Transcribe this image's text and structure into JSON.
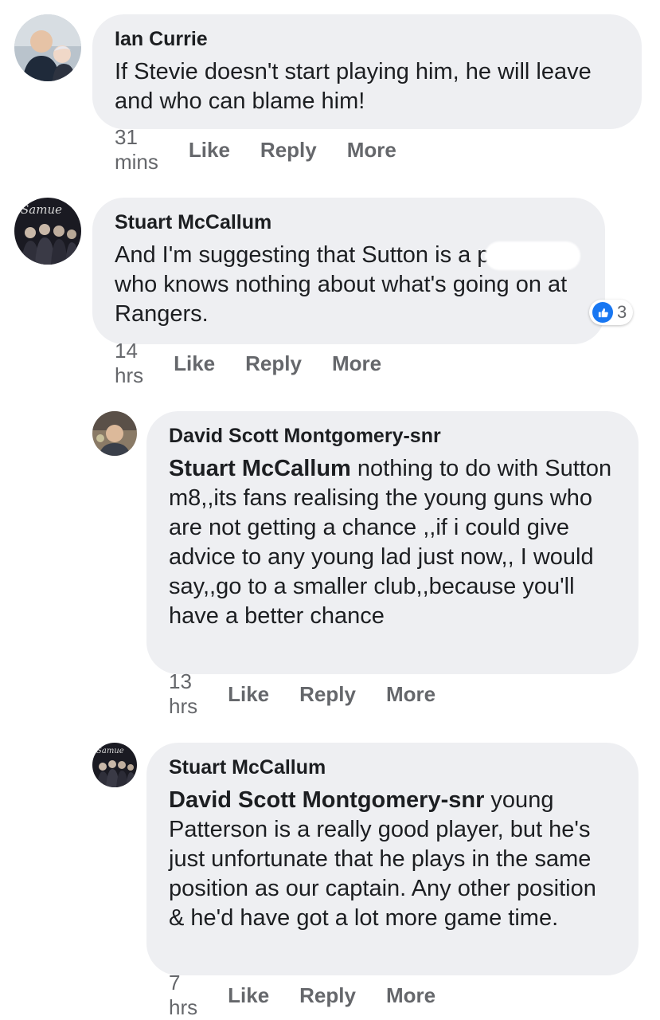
{
  "comments": [
    {
      "author": "Ian Currie",
      "mention": "",
      "text": "If Stevie doesn't start playing him, he will leave and who can blame him!",
      "time": "31 mins",
      "like": "Like",
      "reply": "Reply",
      "more": "More"
    },
    {
      "author": "Stuart McCallum",
      "mention": "",
      "text_before": "And I'm suggesting that Sutton is a p",
      "text_after": "who knows nothing about what's going on at Rangers.",
      "reaction_count": "3",
      "time": "14 hrs",
      "like": "Like",
      "reply": "Reply",
      "more": "More"
    },
    {
      "author": "David Scott Montgomery-snr",
      "mention": "Stuart McCallum",
      "text": " nothing to do with Sutton m8,,its fans realising the young guns who are not getting a chance ,,if i could give advice to any young lad just now,, I would say,,go to a smaller club,,because you'll have a better chance",
      "time": "13 hrs",
      "like": "Like",
      "reply": "Reply",
      "more": "More"
    },
    {
      "author": "Stuart McCallum",
      "mention": "David Scott Montgomery-snr",
      "text": " young Patterson is a really good player, but he's just unfortunate that he plays in the same position as our captain. Any other position & he'd have got a lot more game time.",
      "time": "7 hrs",
      "like": "Like",
      "reply": "Reply",
      "more": "More"
    }
  ],
  "colors": {
    "bubble": "#eeeff2",
    "meta": "#65676b",
    "like_badge": "#1877f2"
  }
}
